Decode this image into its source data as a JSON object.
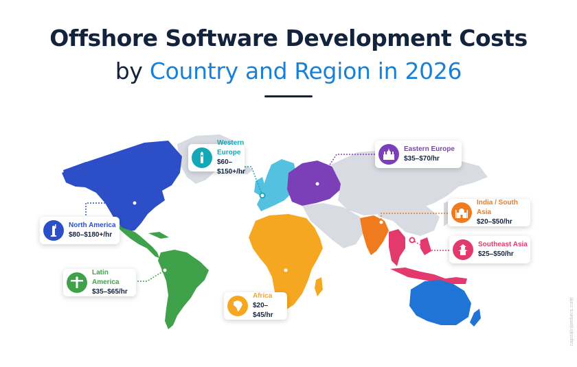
{
  "title": {
    "line1": "Offshore Software Development Costs",
    "line2_prefix": "by",
    "line2_accent": "Country and Region in 2026"
  },
  "regions": [
    {
      "name": "Western Europe",
      "rate": "$60–$150+/hr",
      "color": "#14a7b8",
      "icon": "big-ben-icon"
    },
    {
      "name": "Eastern Europe",
      "rate": "$35–$70/hr",
      "color": "#7b3fb8",
      "icon": "kremlin-icon"
    },
    {
      "name": "North America",
      "rate": "$80–$180+/hr",
      "color": "#2c4fc7",
      "icon": "statue-of-liberty-icon"
    },
    {
      "name": "India / South Asia",
      "rate": "$20–$50/hr",
      "color": "#f07a1e",
      "icon": "taj-mahal-icon"
    },
    {
      "name": "Southeast Asia",
      "rate": "$25–$50/hr",
      "color": "#e23a6c",
      "icon": "pagoda-icon"
    },
    {
      "name": "Latin America",
      "rate": "$35–$65/hr",
      "color": "#3fa24a",
      "icon": "christ-redeemer-icon"
    },
    {
      "name": "Africa",
      "rate": "$20–$45/hr",
      "color": "#f6a721",
      "icon": "africa-continent-icon"
    }
  ],
  "colors": {
    "title_dark": "#14233c",
    "title_accent": "#1a7fd6",
    "land_other": "#d8dbe1",
    "australia": "#1f74d6"
  },
  "watermark": "capitalnumbers.com"
}
